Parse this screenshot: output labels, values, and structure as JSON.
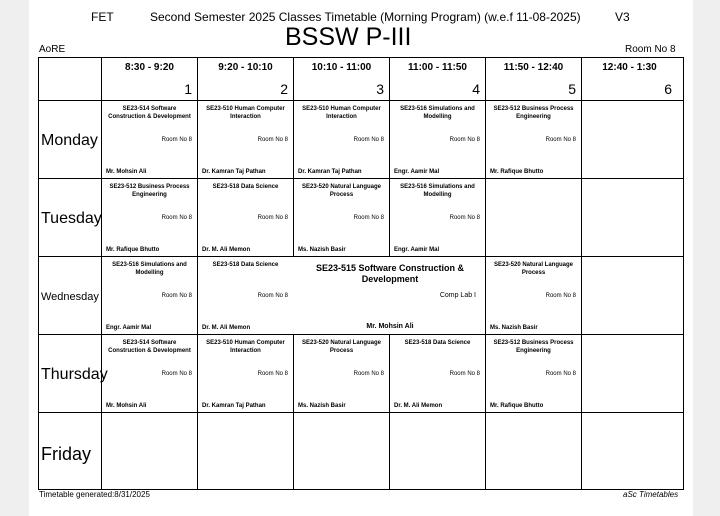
{
  "header": {
    "institute": "FET",
    "title": "Second Semester 2025 Classes Timetable (Morning Program) (w.e.f 11-08-2025)",
    "version": "V3",
    "class_name": "BSSW P-III",
    "top_left": "AoRE",
    "room": "Room No 8"
  },
  "periods": [
    {
      "time": "8:30 - 9:20",
      "num": "1"
    },
    {
      "time": "9:20 - 10:10",
      "num": "2"
    },
    {
      "time": "10:10 - 11:00",
      "num": "3"
    },
    {
      "time": "11:00 - 11:50",
      "num": "4"
    },
    {
      "time": "11:50 - 12:40",
      "num": "5"
    },
    {
      "time": "12:40 - 1:30",
      "num": "6"
    }
  ],
  "days": [
    "Monday",
    "Tuesday",
    "Wednesday",
    "Thursday",
    "Friday"
  ],
  "schedule": {
    "monday": [
      {
        "title": "SE23-514 Software Construction & Development",
        "room": "Room No 8",
        "instructor": "Mr. Mohsin Ali"
      },
      {
        "title": "SE23-510 Human Computer Interaction",
        "room": "Room No 8",
        "instructor": "Dr. Kamran Taj Pathan"
      },
      {
        "title": "SE23-510 Human Computer Interaction",
        "room": "Room No 8",
        "instructor": "Dr. Kamran Taj Pathan"
      },
      {
        "title": "SE23-516 Simulations and Modelling",
        "room": "Room No 8",
        "instructor": "Engr. Aamir Mal"
      },
      {
        "title": "SE23-512 Business Process Engineering",
        "room": "Room No 8",
        "instructor": "Mr. Rafique Bhutto"
      }
    ],
    "tuesday": [
      {
        "title": "SE23-512 Business Process Engineering",
        "room": "Room No 8",
        "instructor": "Mr. Rafique Bhutto"
      },
      {
        "title": "SE23-518 Data Science",
        "room": "Room No 8",
        "instructor": "Dr. M. Ali Memon"
      },
      {
        "title": "SE23-520 Natural Language Process",
        "room": "Room No 8",
        "instructor": "Ms. Nazish Basir"
      },
      {
        "title": "SE23-516 Simulations and Modelling",
        "room": "Room No 8",
        "instructor": "Engr. Aamir Mal"
      }
    ],
    "wednesday": [
      {
        "title": "SE23-516 Simulations and Modelling",
        "room": "Room No 8",
        "instructor": "Engr. Aamir Mal"
      },
      {
        "title": "SE23-518 Data Science",
        "room": "Room No 8",
        "instructor": "Dr. M. Ali Memon"
      },
      {
        "title": "SE23-515 Software Construction & Development",
        "room": "Comp Lab I",
        "instructor": "Mr. Mohsin Ali"
      },
      {
        "title": "SE23-520 Natural Language Process",
        "room": "Room No 8",
        "instructor": "Ms. Nazish Basir"
      }
    ],
    "thursday": [
      {
        "title": "SE23-514 Software Construction & Development",
        "room": "Room No 8",
        "instructor": "Mr. Mohsin Ali"
      },
      {
        "title": "SE23-510 Human Computer Interaction",
        "room": "Room No 8",
        "instructor": "Dr. Kamran Taj Pathan"
      },
      {
        "title": "SE23-520 Natural Language Process",
        "room": "Room No 8",
        "instructor": "Ms. Nazish Basir"
      },
      {
        "title": "SE23-518 Data Science",
        "room": "Room No 8",
        "instructor": "Dr. M. Ali Memon"
      },
      {
        "title": "SE23-512 Business Process Engineering",
        "room": "Room No 8",
        "instructor": "Mr. Rafique Bhutto"
      }
    ]
  },
  "footer": {
    "generated": "Timetable generated:8/31/2025",
    "software": "aSc Timetables"
  }
}
